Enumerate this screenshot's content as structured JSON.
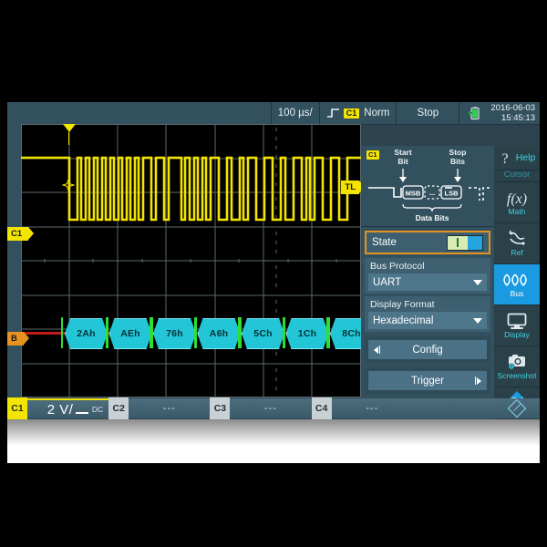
{
  "topbar": {
    "timebase": "100 µs/",
    "slope_icon": "rising-edge-icon",
    "trigger_source": "C1",
    "trigger_mode": "Norm",
    "acquisition_state": "Stop",
    "battery_icon": "battery-charging-icon",
    "date": "2016-06-03",
    "time": "15:45:13"
  },
  "plot": {
    "channel_marker": "C1",
    "bus_marker": "B",
    "trigger_level_marker": "TL",
    "trigger_position_icon": "trigger-position-icon",
    "waveform_color": "#f3e500",
    "bus_color": "#22c6d6",
    "frame_bracket_color": "#2ee02e",
    "bus_line_color": "#c01c1c"
  },
  "decode": {
    "format": "Hexadecimal",
    "frames": [
      "2Ah",
      "AEh",
      "76h",
      "A6h",
      "5Ch",
      "1Ch",
      "8Ch"
    ]
  },
  "uart_diagram": {
    "channel_tag": "C1",
    "start_label_line1": "Start",
    "start_label_line2": "Bit",
    "stop_label_line1": "Stop",
    "stop_label_line2": "Bits",
    "msb_label": "MSB",
    "mid_label": "...",
    "lsb_label": "LSB",
    "data_bits_label": "Data Bits"
  },
  "panel": {
    "state_label": "State",
    "state_on": true,
    "bus_protocol_caption": "Bus Protocol",
    "bus_protocol_value": "UART",
    "display_format_caption": "Display Format",
    "display_format_value": "Hexadecimal",
    "config_button": "Config",
    "trigger_button": "Trigger",
    "highlight_color": "#e8921f"
  },
  "sidebar": {
    "items": [
      {
        "label": "Help",
        "icon": "question-mark-icon",
        "active": false
      },
      {
        "label": "Cursor",
        "icon": "cursor-icon",
        "active": false
      },
      {
        "label": "Math",
        "icon": "fx-function-icon",
        "active": false
      },
      {
        "label": "Ref",
        "icon": "reference-curve-icon",
        "active": false
      },
      {
        "label": "Bus",
        "icon": "bus-signal-icon",
        "active": true
      },
      {
        "label": "Display",
        "icon": "monitor-icon",
        "active": false
      },
      {
        "label": "Screenshot",
        "icon": "camera-gear-icon",
        "active": false
      }
    ],
    "logo": "rohde-schwarz-logo",
    "active_color": "#1a9ae0",
    "label_color": "#3fd2e0"
  },
  "channel_bar": {
    "channels": [
      {
        "name": "C1",
        "value": "2 V/",
        "coupling": "DC",
        "selected": true,
        "tag_color": "#f3e500"
      },
      {
        "name": "C2",
        "value": "---",
        "coupling": "",
        "selected": false,
        "tag_color": "#c8d2d6"
      },
      {
        "name": "C3",
        "value": "---",
        "coupling": "",
        "selected": false,
        "tag_color": "#c8d2d6"
      },
      {
        "name": "C4",
        "value": "---",
        "coupling": "",
        "selected": false,
        "tag_color": "#c8d2d6"
      }
    ]
  }
}
